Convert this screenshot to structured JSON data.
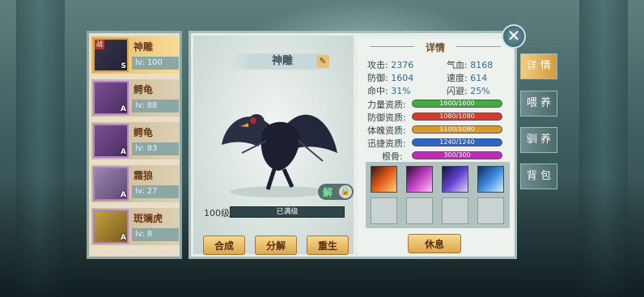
{
  "pets": [
    {
      "name": "神雕",
      "level": "lv: 100",
      "grade": "S",
      "selected": true,
      "mark": "战"
    },
    {
      "name": "鳄龟",
      "level": "lv: 88",
      "grade": "A",
      "selected": false
    },
    {
      "name": "鳄龟",
      "level": "lv: 83",
      "grade": "A",
      "selected": false
    },
    {
      "name": "霜狼",
      "level": "lv: 27",
      "grade": "A",
      "selected": false
    },
    {
      "name": "斑斓虎",
      "level": "lv: 8",
      "grade": "A",
      "selected": false
    }
  ],
  "detail": {
    "pet_name": "神雕",
    "unlock_label": "解",
    "level_label": "100级",
    "exp_text": "已满级",
    "buttons": {
      "merge": "合成",
      "decompose": "分解",
      "rebirth": "重生",
      "rest": "休息"
    },
    "panel_title": "详情",
    "stats": [
      {
        "label": "攻击:",
        "value": "2376"
      },
      {
        "label": "气血:",
        "value": "8168"
      },
      {
        "label": "防御:",
        "value": "1604"
      },
      {
        "label": "速度:",
        "value": "614"
      },
      {
        "label": "命中:",
        "value": "31%"
      },
      {
        "label": "闪避:",
        "value": "25%"
      }
    ],
    "aptitudes": [
      {
        "label": "力量资质:",
        "value": "1600/1600",
        "color": "#3fae3f",
        "fill": 1.0
      },
      {
        "label": "防御资质:",
        "value": "1080/1080",
        "color": "#d33a2a",
        "fill": 1.0
      },
      {
        "label": "体魄资质:",
        "value": "1100/1080",
        "color": "#d99a2a",
        "fill": 1.0
      },
      {
        "label": "迅捷资质:",
        "value": "1240/1240",
        "color": "#2b63c8",
        "fill": 1.0
      },
      {
        "label": "根骨:",
        "value": "300/300",
        "color": "#c22ab8",
        "fill": 1.0
      }
    ]
  },
  "side_tabs": [
    "详 情",
    "喂 养",
    "驯 养",
    "背 包"
  ]
}
